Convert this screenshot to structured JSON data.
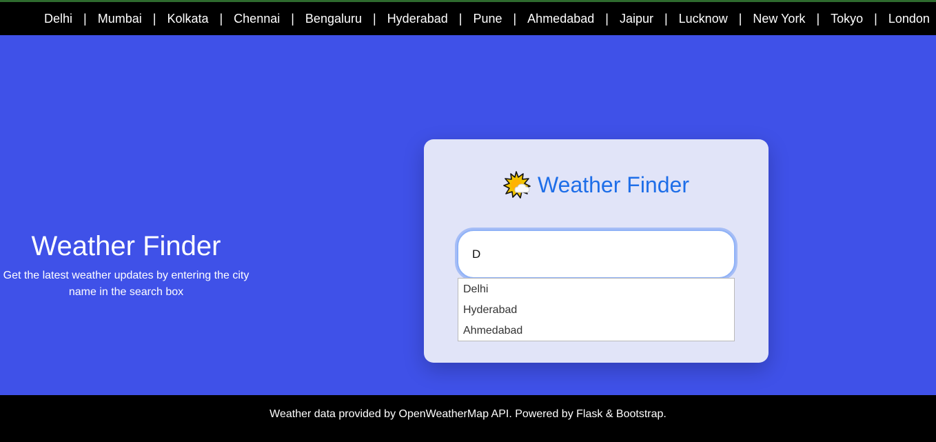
{
  "nav": {
    "cities": [
      "Delhi",
      "Mumbai",
      "Kolkata",
      "Chennai",
      "Bengaluru",
      "Hyderabad",
      "Pune",
      "Ahmedabad",
      "Jaipur",
      "Lucknow",
      "New York",
      "Tokyo",
      "London"
    ],
    "separator": "|"
  },
  "hero": {
    "title": "Weather Finder",
    "subtitle": "Get the latest weather updates by entering the city name in the search box"
  },
  "card": {
    "icon": "sun-cloud-icon",
    "title": "Weather Finder",
    "search_value": "D",
    "suggestions": [
      "Delhi",
      "Hyderabad",
      "Ahmedabad"
    ]
  },
  "footer": {
    "text": "Weather data provided by OpenWeatherMap API. Powered by Flask & Bootstrap."
  },
  "colors": {
    "background": "#3f51e8",
    "card": "#e1e4f8",
    "accent": "#1e6ee8",
    "bar": "#000000",
    "topbar_border": "#2e6b2e"
  }
}
